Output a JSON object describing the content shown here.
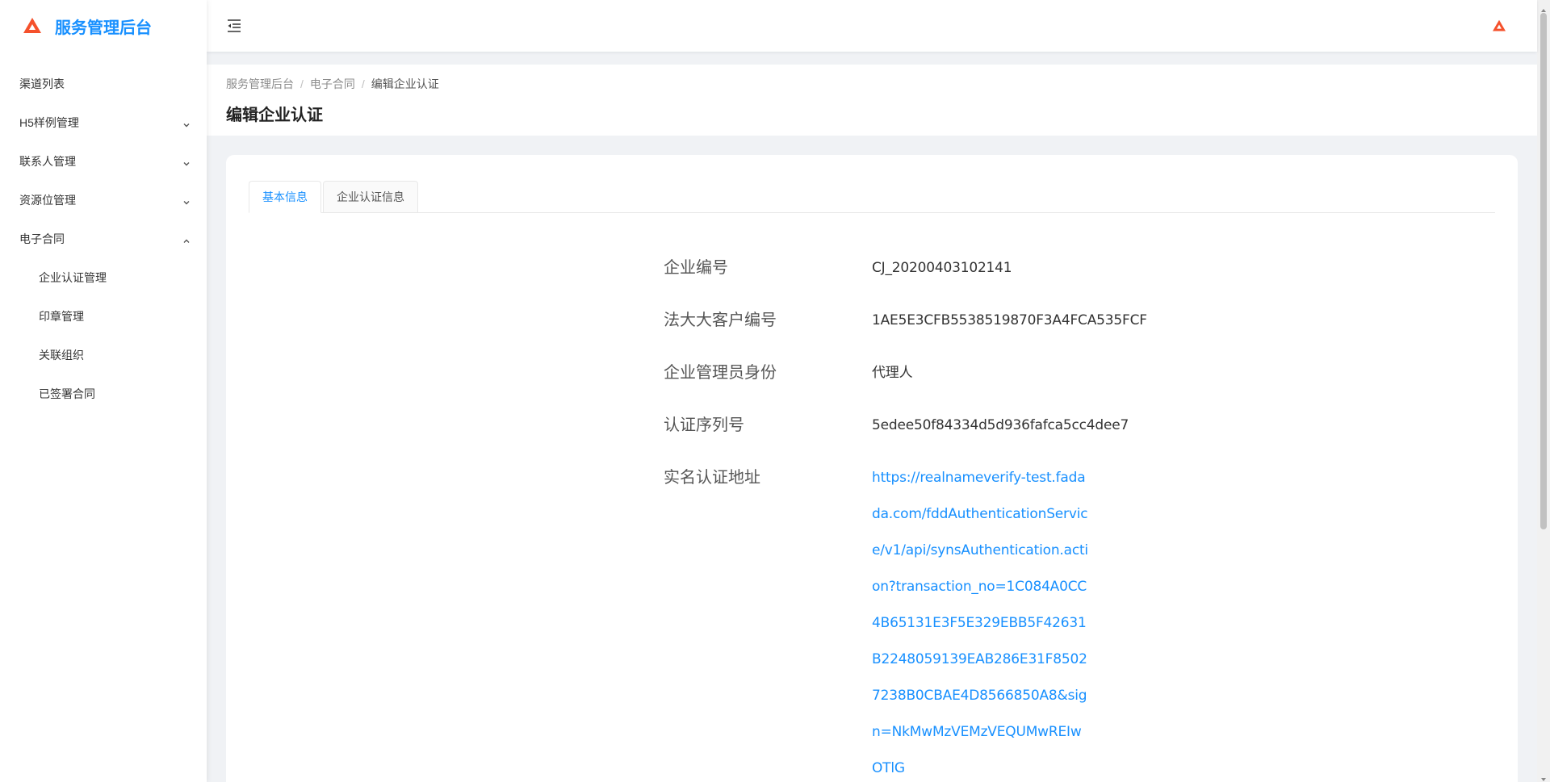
{
  "app": {
    "title": "服务管理后台"
  },
  "sidebar": {
    "items": [
      {
        "label": "渠道列表",
        "chevron": ""
      },
      {
        "label": "H5样例管理",
        "chevron": "down"
      },
      {
        "label": "联系人管理",
        "chevron": "down"
      },
      {
        "label": "资源位管理",
        "chevron": "down"
      },
      {
        "label": "电子合同",
        "chevron": "up"
      },
      {
        "label": "企业认证管理",
        "chevron": ""
      },
      {
        "label": "印章管理",
        "chevron": ""
      },
      {
        "label": "关联组织",
        "chevron": ""
      },
      {
        "label": "已签署合同",
        "chevron": ""
      }
    ]
  },
  "breadcrumb": {
    "items": [
      "服务管理后台",
      "电子合同",
      "编辑企业认证"
    ],
    "separator": "/"
  },
  "page": {
    "title": "编辑企业认证"
  },
  "tabs": [
    {
      "label": "基本信息",
      "active": true
    },
    {
      "label": "企业认证信息",
      "active": false
    }
  ],
  "details": [
    {
      "label": "企业编号",
      "value": "CJ_20200403102141"
    },
    {
      "label": "法大大客户编号",
      "value": "1AE5E3CFB5538519870F3A4FCA535FCF"
    },
    {
      "label": "企业管理员身份",
      "value": "代理人"
    },
    {
      "label": "认证序列号",
      "value": "5edee50f84334d5d936fafca5cc4dee7"
    },
    {
      "label": "实名认证地址",
      "value": "https://realnameverify-test.fadada.com/fddAuthenticationService/v1/api/synsAuthentication.action?transaction_no=1C084A0CC4B65131E3F5E329EBB5F42631B2248059139EAB286E31F85027238B0CBAE4D8566850A8&sign=NkMwMzVEMzVEQUMwREIwOTlG"
    }
  ],
  "colors": {
    "accent": "#1890ff",
    "logo": "#f5512c"
  },
  "icons": {
    "logo": "logo-icon",
    "fold": "menu-fold-icon",
    "chevron_down": "chevron-down-icon",
    "chevron_up": "chevron-up-icon"
  }
}
